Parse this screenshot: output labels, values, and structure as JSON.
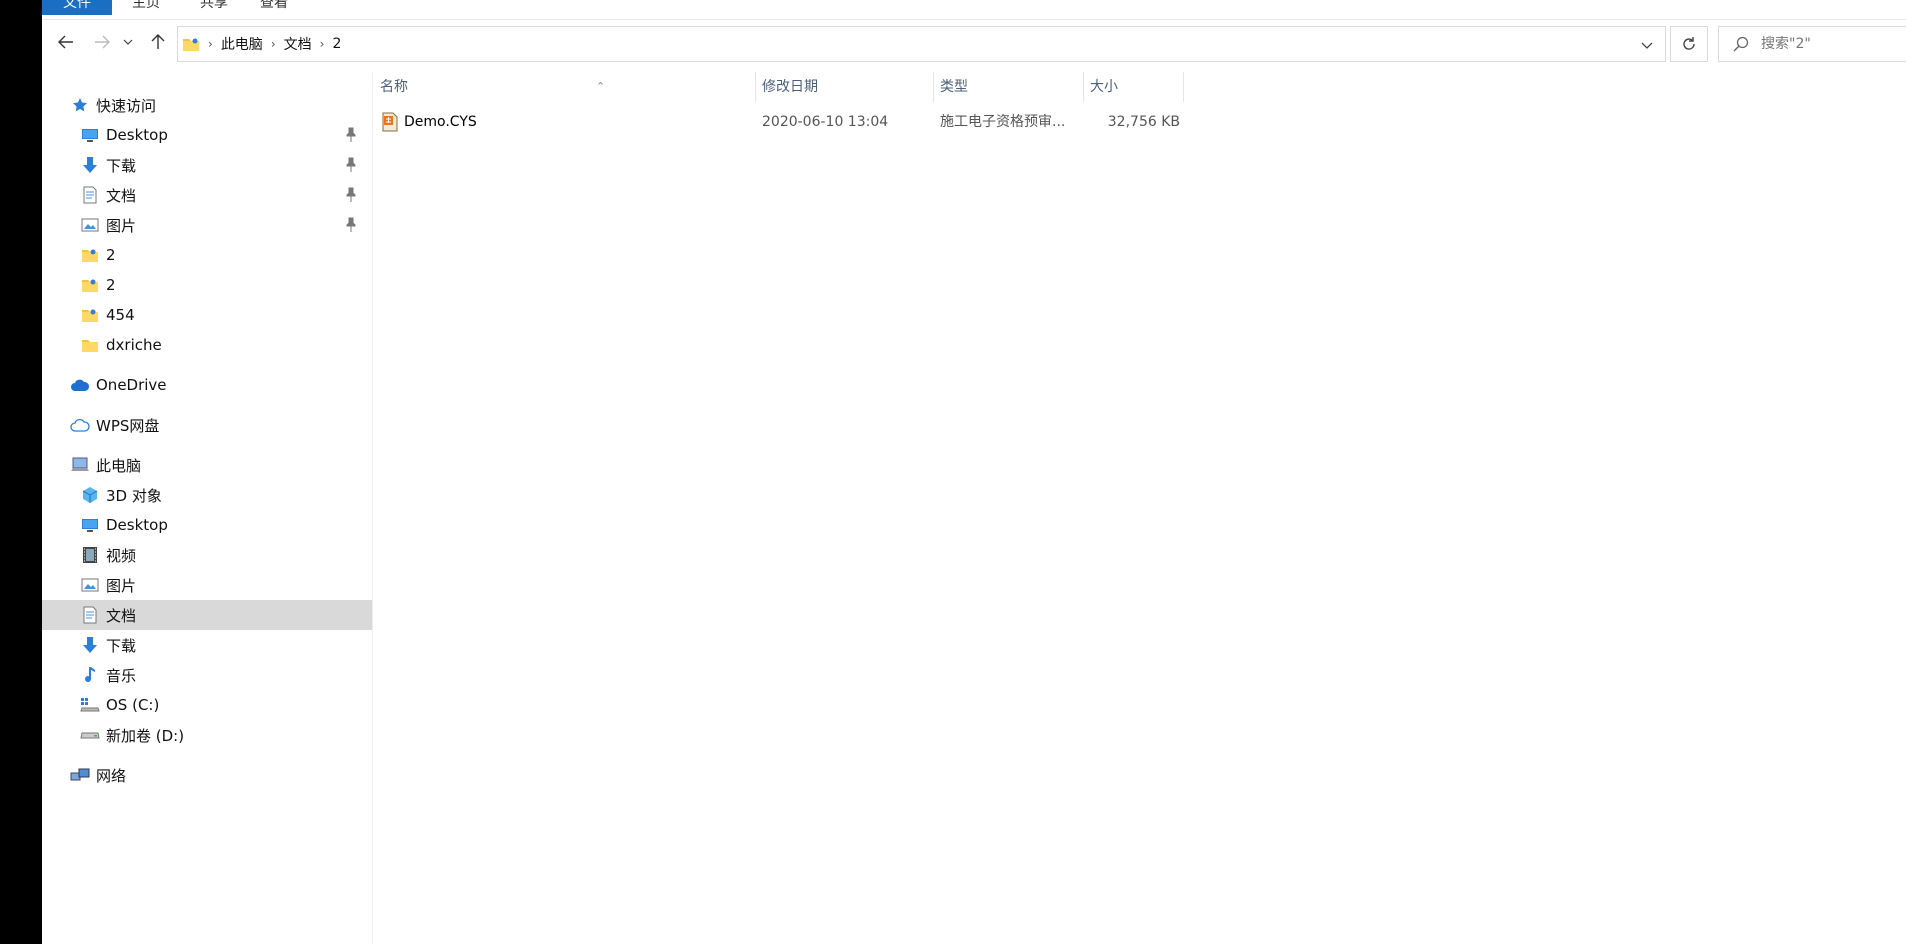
{
  "ribbon": {
    "tabs": [
      {
        "label": "文件",
        "active": true
      },
      {
        "label": "主页",
        "active": false
      },
      {
        "label": "共享",
        "active": false
      },
      {
        "label": "查看",
        "active": false
      }
    ]
  },
  "address": {
    "breadcrumbs": [
      "此电脑",
      "文档",
      "2"
    ],
    "search_placeholder": "搜索\"2\""
  },
  "sidebar": {
    "quick_access": {
      "label": "快速访问",
      "items": [
        {
          "label": "Desktop",
          "icon": "desktop-icon",
          "pinned": true
        },
        {
          "label": "下载",
          "icon": "download-icon",
          "pinned": true
        },
        {
          "label": "文档",
          "icon": "document-icon",
          "pinned": true
        },
        {
          "label": "图片",
          "icon": "pictures-icon",
          "pinned": true
        },
        {
          "label": "2",
          "icon": "folder-icon",
          "pinned": false
        },
        {
          "label": "2",
          "icon": "folder-icon",
          "pinned": false
        },
        {
          "label": "454",
          "icon": "folder-icon",
          "pinned": false
        },
        {
          "label": "dxriche",
          "icon": "folder-icon",
          "pinned": false
        }
      ]
    },
    "onedrive": {
      "label": "OneDrive"
    },
    "wps": {
      "label": "WPS网盘"
    },
    "this_pc": {
      "label": "此电脑",
      "items": [
        {
          "label": "3D 对象",
          "icon": "3d-objects-icon"
        },
        {
          "label": "Desktop",
          "icon": "desktop-icon"
        },
        {
          "label": "视频",
          "icon": "video-icon"
        },
        {
          "label": "图片",
          "icon": "pictures-icon"
        },
        {
          "label": "文档",
          "icon": "document-icon",
          "selected": true
        },
        {
          "label": "下载",
          "icon": "download-icon"
        },
        {
          "label": "音乐",
          "icon": "music-icon"
        },
        {
          "label": "OS (C:)",
          "icon": "system-drive-icon"
        },
        {
          "label": "新加卷 (D:)",
          "icon": "drive-icon"
        }
      ]
    },
    "network": {
      "label": "网络"
    }
  },
  "table": {
    "columns": [
      "名称",
      "修改日期",
      "类型",
      "大小"
    ],
    "rows": [
      {
        "name": "Demo.CYS",
        "modified": "2020-06-10 13:04",
        "type": "施工电子资格预审...",
        "size": "32,756 KB"
      }
    ]
  },
  "colors": {
    "accent": "#1a6fc4",
    "selected_bg": "#d9d9d9",
    "header_text": "#4c607a"
  }
}
